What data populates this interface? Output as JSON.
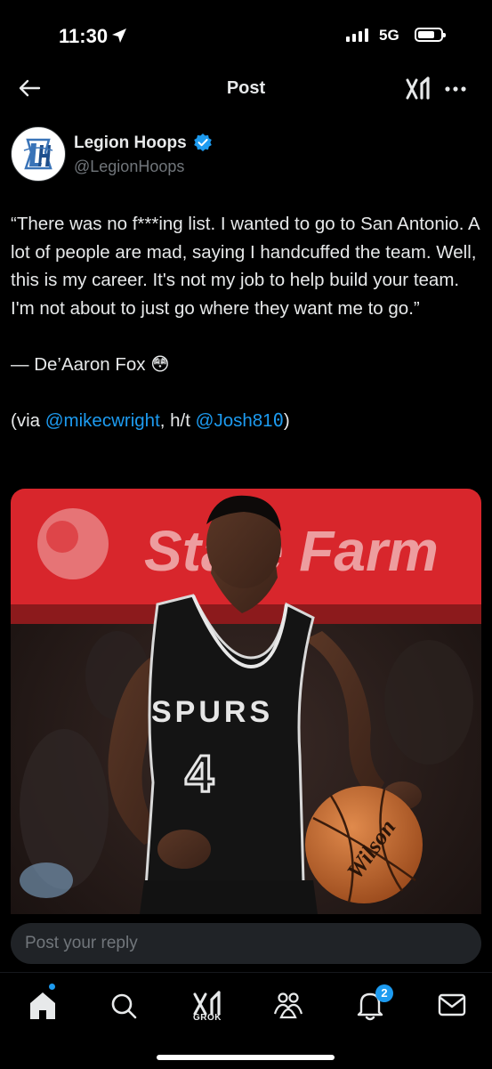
{
  "status_bar": {
    "time": "11:30",
    "network": "5G",
    "battery_level": 0.75
  },
  "header": {
    "title": "Post",
    "back_icon": "arrow-left-icon",
    "grok_icon": "grok-icon",
    "more_icon": "more-horizontal-icon"
  },
  "author": {
    "name": "Legion Hoops",
    "handle": "@LegionHoops",
    "verified": true
  },
  "tweet": {
    "quote": "“There was no f***ing list. I wanted to go to San Antonio. A lot of people are mad, saying I handcuffed the team. Well, this is my career. It's not my job to help build your team. I'm not about to just go where they want me to go.”",
    "attribution": "— De’Aaron Fox",
    "emoji": "😳",
    "via_prefix": "(via ",
    "via_link1": "@mikecwright",
    "via_mid": ", h/t ",
    "via_link2": "@Josh81",
    "via_zero": "0",
    "via_suffix": ")"
  },
  "media": {
    "banner_text": "State Farm",
    "jersey_team": "SPURS",
    "jersey_number": "4",
    "ball_brand": "Wilson"
  },
  "reply": {
    "placeholder": "Post your reply"
  },
  "tab_bar": {
    "grok_label": "GROK",
    "notifications_count": "2"
  },
  "colors": {
    "background": "#000000",
    "accent": "#1d9bf0",
    "muted": "#71767b",
    "text": "#e7e9ea"
  }
}
